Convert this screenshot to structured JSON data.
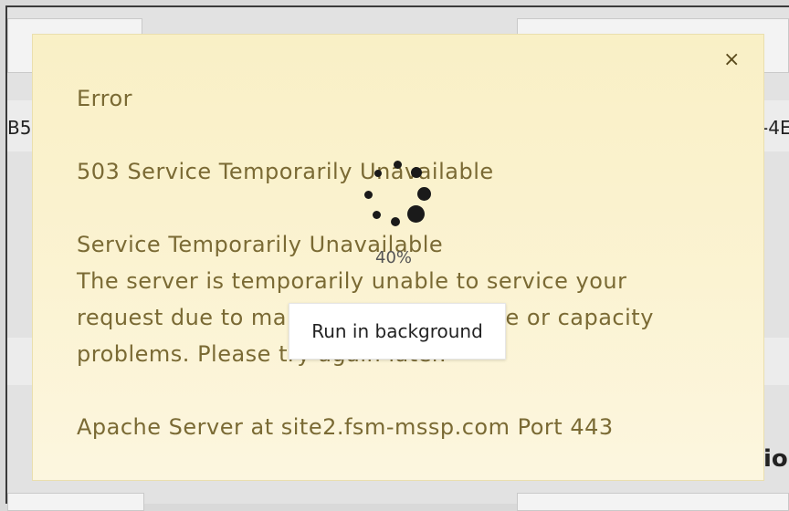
{
  "background": {
    "left_fragment": "B5",
    "right_fragment": "-4E",
    "bottom_right_fragment": "ior"
  },
  "dialog": {
    "close_glyph": "×",
    "title": "Error",
    "status_heading": "503 Service Temporarily Unavailable",
    "message_heading": "Service Temporarily Unavailable",
    "message_line_1": "The server is temporarily unable to service your",
    "message_line_2": "request due to maintenance downtime or capacity",
    "message_line_3": "problems. Please try again later.",
    "server_info": "Apache Server at site2.fsm-mssp.com Port 443"
  },
  "loader": {
    "progress_text": "40%",
    "progress_value": 0.4,
    "run_in_background_label": "Run in background"
  },
  "colors": {
    "dialog_bg": "#fbf3d2",
    "dialog_text": "#7a6a34"
  }
}
